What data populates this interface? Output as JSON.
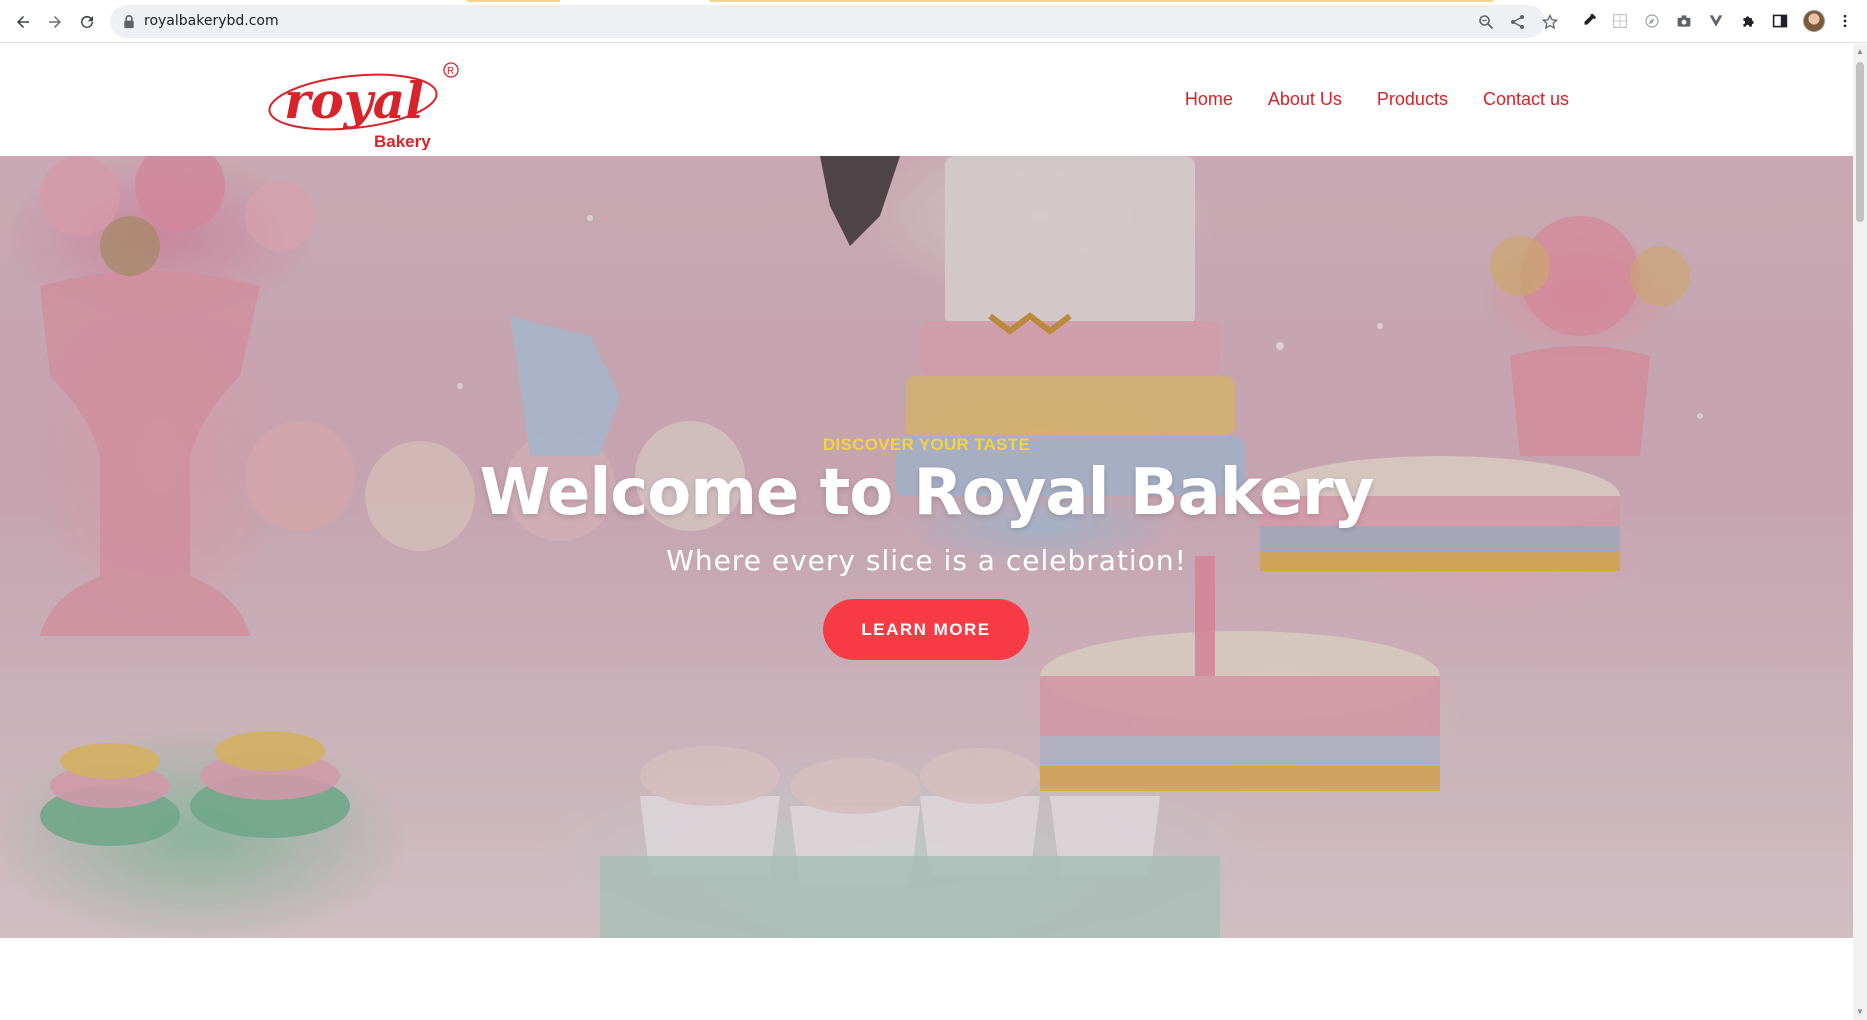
{
  "browser": {
    "url": "royalbakerybd.com"
  },
  "site": {
    "logo_text": "royal",
    "logo_subtext": "Bakery",
    "logo_mark": "R"
  },
  "nav": {
    "items": [
      {
        "label": "Home"
      },
      {
        "label": "About Us"
      },
      {
        "label": "Products"
      },
      {
        "label": "Contact us"
      }
    ]
  },
  "hero": {
    "eyebrow": "DISCOVER YOUR TASTE",
    "title": "Welcome to Royal Bakery",
    "subtitle": "Where every slice is a celebration!",
    "cta_label": "LEARN MORE"
  },
  "colors": {
    "brand_red": "#d72329",
    "cta_red": "#f73b45",
    "eyebrow_yellow": "#f3d33c"
  },
  "icons": {
    "back": "arrow-left-icon",
    "forward": "arrow-right-icon",
    "reload": "reload-icon",
    "lock": "lock-icon",
    "zoom": "zoom-icon",
    "share": "share-icon",
    "bookmark": "star-icon",
    "extensions": "puzzle-icon",
    "menu": "kebab-menu-icon"
  }
}
